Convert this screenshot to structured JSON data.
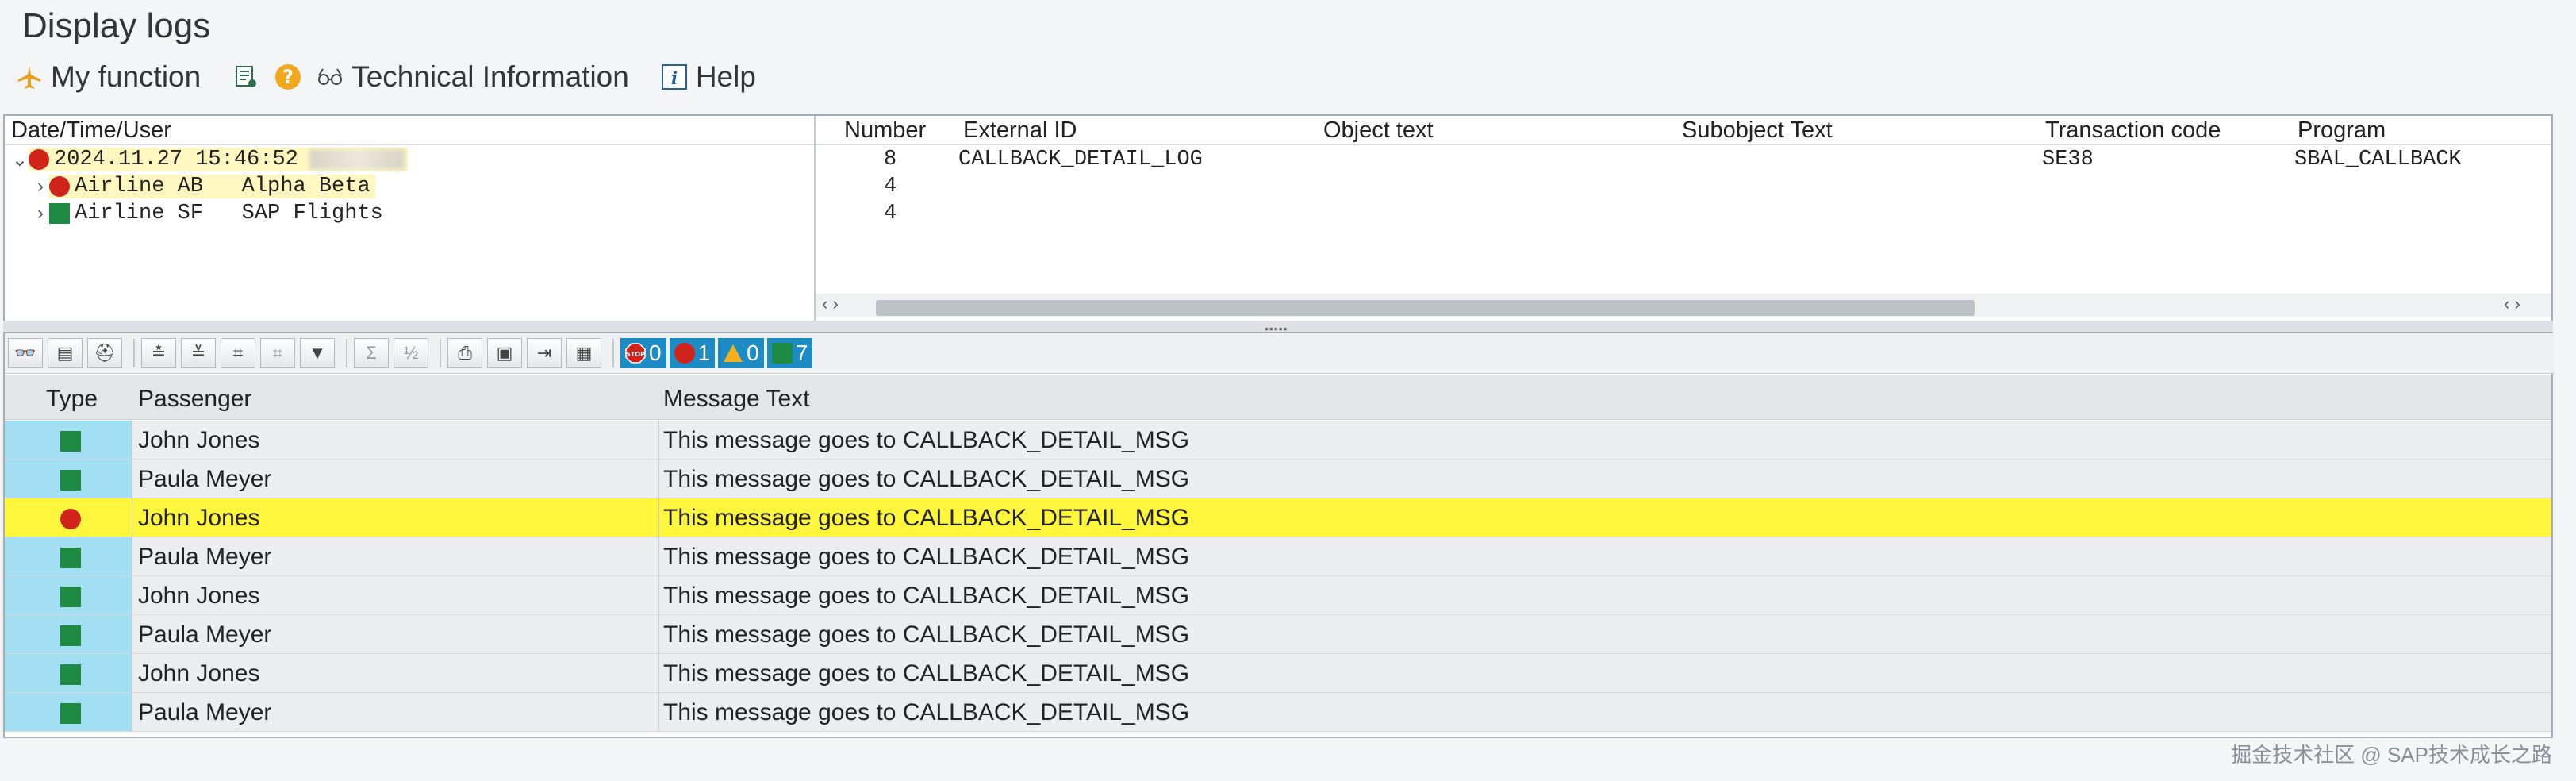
{
  "window": {
    "title": "Display logs"
  },
  "toolbar": {
    "my_function": "My function",
    "technical_information": "Technical Information",
    "help": "Help"
  },
  "upper": {
    "tree_header": "Date/Time/User",
    "tree": [
      {
        "label": "2024.11.27  15:46:52",
        "status": "error",
        "expanded": true
      },
      {
        "label": "Airline AB   Alpha Beta",
        "status": "error",
        "expanded": false
      },
      {
        "label": "Airline SF   SAP Flights",
        "status": "success",
        "expanded": false
      }
    ],
    "columns": [
      "Number",
      "External ID",
      "Object text",
      "Subobject Text",
      "Transaction code",
      "Program"
    ],
    "rows": [
      {
        "number": "8",
        "external_id": "CALLBACK_DETAIL_LOG",
        "object_text": "",
        "subobject_text": "",
        "transaction_code": "SE38",
        "program": "SBAL_CALLBACK"
      },
      {
        "number": "4",
        "external_id": "",
        "object_text": "",
        "subobject_text": "",
        "transaction_code": "",
        "program": ""
      },
      {
        "number": "4",
        "external_id": "",
        "object_text": "",
        "subobject_text": "",
        "transaction_code": "",
        "program": ""
      }
    ]
  },
  "counters": {
    "stop": "0",
    "error": "1",
    "warning": "0",
    "success": "7"
  },
  "grid": {
    "columns": {
      "type": "Type",
      "passenger": "Passenger",
      "message": "Message Text"
    },
    "rows": [
      {
        "type": "success",
        "passenger": "John Jones",
        "message": "This message goes to CALLBACK_DETAIL_MSG"
      },
      {
        "type": "success",
        "passenger": "Paula Meyer",
        "message": "This message goes to CALLBACK_DETAIL_MSG"
      },
      {
        "type": "error",
        "passenger": "John Jones",
        "message": "This message goes to CALLBACK_DETAIL_MSG",
        "selected": true
      },
      {
        "type": "success",
        "passenger": "Paula Meyer",
        "message": "This message goes to CALLBACK_DETAIL_MSG"
      },
      {
        "type": "success",
        "passenger": "John Jones",
        "message": "This message goes to CALLBACK_DETAIL_MSG"
      },
      {
        "type": "success",
        "passenger": "Paula Meyer",
        "message": "This message goes to CALLBACK_DETAIL_MSG"
      },
      {
        "type": "success",
        "passenger": "John Jones",
        "message": "This message goes to CALLBACK_DETAIL_MSG"
      },
      {
        "type": "success",
        "passenger": "Paula Meyer",
        "message": "This message goes to CALLBACK_DETAIL_MSG"
      }
    ]
  },
  "watermark": "掘金技术社区 @ SAP技术成长之路",
  "colors": {
    "error": "#d0241b",
    "success": "#1e8a43",
    "selected_row": "#fef63c",
    "type_cell": "#a3dff2",
    "counter_bg": "#1d8bc4"
  }
}
